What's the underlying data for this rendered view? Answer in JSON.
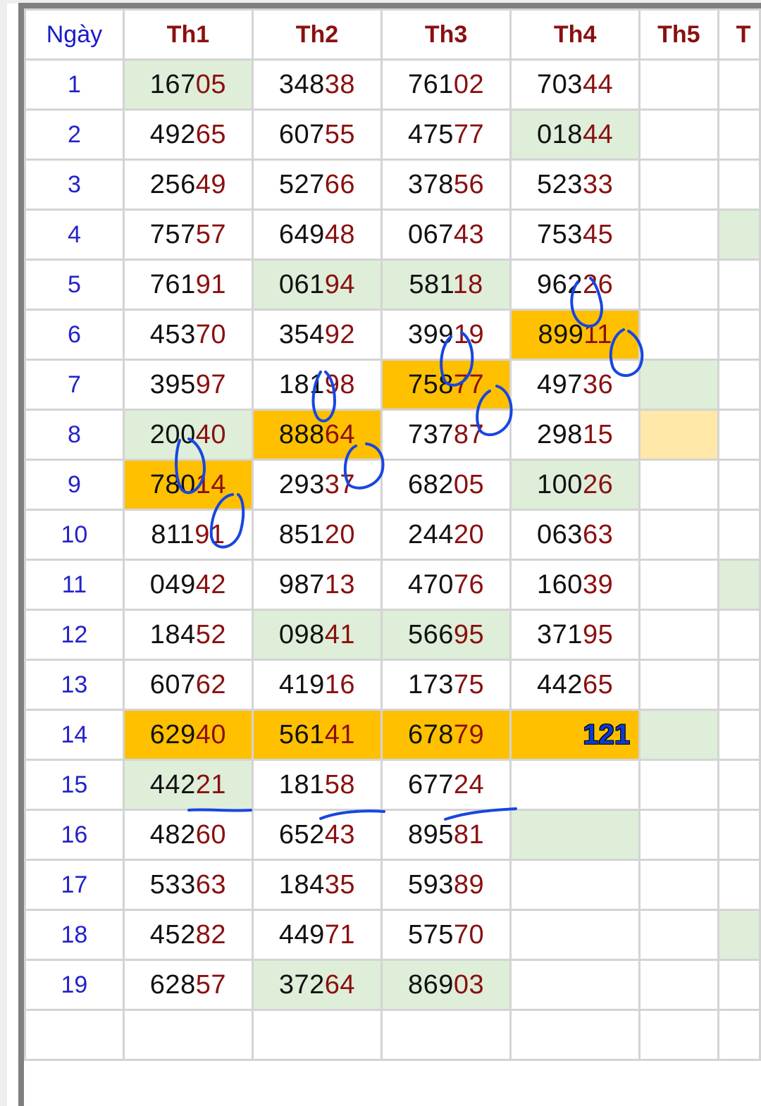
{
  "header": {
    "day_label": "Ngày",
    "col_th1": "Th1",
    "col_th2": "Th2",
    "col_th3": "Th3",
    "col_th4": "Th4",
    "col_th5": "Th5",
    "col_th6_partial": "T"
  },
  "rows": [
    {
      "day": "1",
      "th1": {
        "h": "167",
        "t": "05",
        "bg": "green"
      },
      "th2": {
        "h": "348",
        "t": "38"
      },
      "th3": {
        "h": "761",
        "t": "02"
      },
      "th4": {
        "h": "703",
        "t": "44"
      },
      "th5": {},
      "th6": {}
    },
    {
      "day": "2",
      "th1": {
        "h": "492",
        "t": "65"
      },
      "th2": {
        "h": "607",
        "t": "55"
      },
      "th3": {
        "h": "475",
        "t": "77"
      },
      "th4": {
        "h": "018",
        "t": "44",
        "bg": "green"
      },
      "th5": {},
      "th6": {}
    },
    {
      "day": "3",
      "th1": {
        "h": "256",
        "t": "49"
      },
      "th2": {
        "h": "527",
        "t": "66"
      },
      "th3": {
        "h": "378",
        "t": "56"
      },
      "th4": {
        "h": "523",
        "t": "33"
      },
      "th5": {},
      "th6": {}
    },
    {
      "day": "4",
      "th1": {
        "h": "757",
        "t": "57"
      },
      "th2": {
        "h": "649",
        "t": "48"
      },
      "th3": {
        "h": "067",
        "t": "43"
      },
      "th4": {
        "h": "753",
        "t": "45"
      },
      "th5": {},
      "th6": {
        "bg": "green"
      }
    },
    {
      "day": "5",
      "th1": {
        "h": "761",
        "t": "91"
      },
      "th2": {
        "h": "061",
        "t": "94",
        "bg": "green"
      },
      "th3": {
        "h": "581",
        "t": "18",
        "bg": "green"
      },
      "th4": {
        "h": "962",
        "t": "26"
      },
      "th5": {},
      "th6": {}
    },
    {
      "day": "6",
      "th1": {
        "h": "453",
        "t": "70"
      },
      "th2": {
        "h": "354",
        "t": "92"
      },
      "th3": {
        "h": "399",
        "t": "19"
      },
      "th4": {
        "h": "899",
        "t": "11",
        "bg": "orange"
      },
      "th5": {},
      "th6": {}
    },
    {
      "day": "7",
      "th1": {
        "h": "395",
        "t": "97"
      },
      "th2": {
        "h": "181",
        "t": "98"
      },
      "th3": {
        "h": "758",
        "t": "77",
        "bg": "orange"
      },
      "th4": {
        "h": "497",
        "t": "36"
      },
      "th5": {
        "bg": "green"
      },
      "th6": {}
    },
    {
      "day": "8",
      "th1": {
        "h": "200",
        "t": "40",
        "bg": "green"
      },
      "th2": {
        "h": "888",
        "t": "64",
        "bg": "orange"
      },
      "th3": {
        "h": "737",
        "t": "87"
      },
      "th4": {
        "h": "298",
        "t": "15"
      },
      "th5": {
        "bg": "yellow"
      },
      "th6": {}
    },
    {
      "day": "9",
      "th1": {
        "h": "780",
        "t": "14",
        "bg": "orange"
      },
      "th2": {
        "h": "293",
        "t": "37"
      },
      "th3": {
        "h": "682",
        "t": "05"
      },
      "th4": {
        "h": "100",
        "t": "26",
        "bg": "green"
      },
      "th5": {},
      "th6": {}
    },
    {
      "day": "10",
      "th1": {
        "h": "811",
        "t": "91"
      },
      "th2": {
        "h": "851",
        "t": "20"
      },
      "th3": {
        "h": "244",
        "t": "20"
      },
      "th4": {
        "h": "063",
        "t": "63"
      },
      "th5": {},
      "th6": {}
    },
    {
      "day": "11",
      "th1": {
        "h": "049",
        "t": "42"
      },
      "th2": {
        "h": "987",
        "t": "13"
      },
      "th3": {
        "h": "470",
        "t": "76"
      },
      "th4": {
        "h": "160",
        "t": "39"
      },
      "th5": {},
      "th6": {
        "bg": "green"
      }
    },
    {
      "day": "12",
      "th1": {
        "h": "184",
        "t": "52"
      },
      "th2": {
        "h": "098",
        "t": "41",
        "bg": "green"
      },
      "th3": {
        "h": "566",
        "t": "95",
        "bg": "green"
      },
      "th4": {
        "h": "371",
        "t": "95"
      },
      "th5": {},
      "th6": {}
    },
    {
      "day": "13",
      "th1": {
        "h": "607",
        "t": "62"
      },
      "th2": {
        "h": "419",
        "t": "16"
      },
      "th3": {
        "h": "173",
        "t": "75"
      },
      "th4": {
        "h": "442",
        "t": "65"
      },
      "th5": {},
      "th6": {}
    },
    {
      "day": "14",
      "th1": {
        "h": "629",
        "t": "40",
        "bg": "orange"
      },
      "th2": {
        "h": "561",
        "t": "41",
        "bg": "orange"
      },
      "th3": {
        "h": "678",
        "t": "79",
        "bg": "orange"
      },
      "th4": {
        "total": "121",
        "bg": "orange"
      },
      "th5": {
        "bg": "green"
      },
      "th6": {}
    },
    {
      "day": "15",
      "th1": {
        "h": "442",
        "t": "21",
        "bg": "green"
      },
      "th2": {
        "h": "181",
        "t": "58"
      },
      "th3": {
        "h": "677",
        "t": "24"
      },
      "th4": {},
      "th5": {},
      "th6": {}
    },
    {
      "day": "16",
      "th1": {
        "h": "482",
        "t": "60"
      },
      "th2": {
        "h": "652",
        "t": "43"
      },
      "th3": {
        "h": "895",
        "t": "81"
      },
      "th4": {
        "bg": "green"
      },
      "th5": {},
      "th6": {}
    },
    {
      "day": "17",
      "th1": {
        "h": "533",
        "t": "63"
      },
      "th2": {
        "h": "184",
        "t": "35"
      },
      "th3": {
        "h": "593",
        "t": "89"
      },
      "th4": {},
      "th5": {},
      "th6": {}
    },
    {
      "day": "18",
      "th1": {
        "h": "452",
        "t": "82"
      },
      "th2": {
        "h": "449",
        "t": "71"
      },
      "th3": {
        "h": "575",
        "t": "70"
      },
      "th4": {},
      "th5": {},
      "th6": {
        "bg": "green"
      }
    },
    {
      "day": "19",
      "th1": {
        "h": "628",
        "t": "57"
      },
      "th2": {
        "h": "372",
        "t": "64",
        "bg": "green"
      },
      "th3": {
        "h": "869",
        "t": "03",
        "bg": "green"
      },
      "th4": {},
      "th5": {},
      "th6": {}
    },
    {
      "day": "",
      "th1": {},
      "th2": {},
      "th3": {},
      "th4": {},
      "th5": {},
      "th6": {}
    }
  ],
  "colors": {
    "header_red": "#8a1010",
    "day_blue": "#2323c8",
    "highlight_green": "#deeed9",
    "highlight_orange": "#ffc000",
    "highlight_yellow": "#ffe8a8",
    "ink_blue": "#1846e0"
  }
}
